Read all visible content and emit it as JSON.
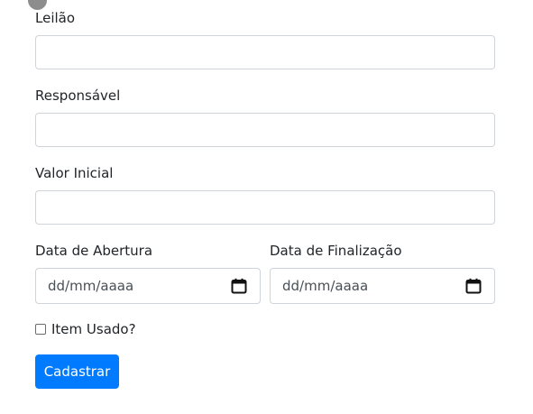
{
  "form": {
    "leilao": {
      "label": "Leilão",
      "value": ""
    },
    "responsavel": {
      "label": "Responsável",
      "value": ""
    },
    "valor_inicial": {
      "label": "Valor Inicial",
      "value": ""
    },
    "data_abertura": {
      "label": "Data de Abertura",
      "placeholder": "dd/mm/aaaa"
    },
    "data_finalizacao": {
      "label": "Data de Finalização",
      "placeholder": "dd/mm/aaaa"
    },
    "item_usado": {
      "label": "Item Usado?",
      "checked": false
    },
    "submit_label": "Cadastrar"
  },
  "colors": {
    "primary": "#007bff",
    "border": "#ced4da",
    "text": "#212529"
  },
  "icons": {
    "date_picker": "calendar-icon"
  }
}
